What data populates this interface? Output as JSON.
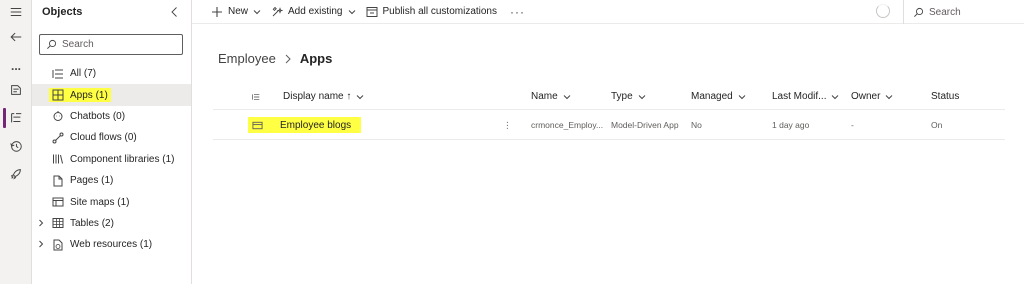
{
  "rail": {
    "items": [
      {
        "icon": "hamburger-icon"
      },
      {
        "icon": "back-arrow-icon"
      },
      {
        "icon": "more-icon",
        "label": "..."
      },
      {
        "icon": "overview-icon"
      },
      {
        "icon": "objects-tree-icon",
        "active": true
      },
      {
        "icon": "history-icon"
      },
      {
        "icon": "rocket-icon"
      }
    ],
    "accent": "#742774"
  },
  "panel": {
    "title": "Objects",
    "search_placeholder": "Search",
    "items": [
      {
        "label": "All",
        "count": "(7)",
        "icon": "list-icon"
      },
      {
        "label": "Apps",
        "count": "(1)",
        "icon": "apps-icon",
        "selected": true,
        "highlighted": true
      },
      {
        "label": "Chatbots",
        "count": "(0)",
        "icon": "chatbot-icon"
      },
      {
        "label": "Cloud flows",
        "count": "(0)",
        "icon": "flow-icon"
      },
      {
        "label": "Component libraries",
        "count": "(1)",
        "icon": "library-icon"
      },
      {
        "label": "Pages",
        "count": "(1)",
        "icon": "page-icon"
      },
      {
        "label": "Site maps",
        "count": "(1)",
        "icon": "sitemap-icon"
      },
      {
        "label": "Tables",
        "count": "(2)",
        "icon": "table-icon",
        "expandable": true
      },
      {
        "label": "Web resources",
        "count": "(1)",
        "icon": "web-resource-icon",
        "expandable": true
      }
    ]
  },
  "commandbar": {
    "new_label": "New",
    "add_existing_label": "Add existing",
    "publish_label": "Publish all customizations",
    "more_label": "···",
    "search_label": "Search"
  },
  "breadcrumb": {
    "parent": "Employee",
    "current": "Apps"
  },
  "table": {
    "columns": {
      "display_name": "Display name",
      "sort_indicator": "↑",
      "name": "Name",
      "type": "Type",
      "managed": "Managed",
      "last_modified": "Last Modif...",
      "owner": "Owner",
      "status": "Status"
    },
    "rows": [
      {
        "display_name": "Employee blogs",
        "more": "⋮",
        "name": "crmonce_Employ...",
        "type": "Model-Driven App",
        "managed": "No",
        "last_modified": "1 day ago",
        "owner": "-",
        "status": "On"
      }
    ]
  },
  "colors": {
    "highlight": "#ffff44",
    "selected_bg": "#edebe9",
    "border": "#e1dfdd"
  }
}
